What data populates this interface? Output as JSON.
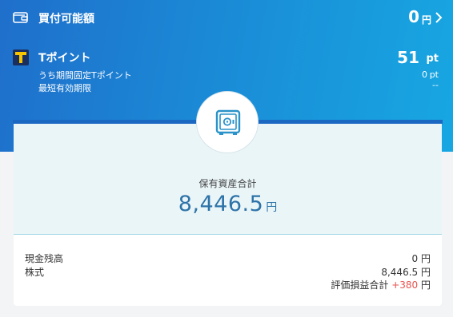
{
  "buying_power": {
    "label": "買付可能額",
    "amount": "0",
    "unit": "円"
  },
  "tpoint": {
    "label": "Tポイント",
    "amount": "51",
    "unit": "pt",
    "fixed_label": "うち期間固定Tポイント",
    "fixed_value": "0",
    "fixed_unit": "pt",
    "expiry_label": "最短有効期限",
    "expiry_value": "--"
  },
  "assets": {
    "total_label": "保有資産合計",
    "total_value": "8,446.5",
    "unit": "円"
  },
  "breakdown": {
    "cash_label": "現金残高",
    "cash_value": "0",
    "stock_label": "株式",
    "stock_value": "8,446.5",
    "pl_label": "評価損益合計",
    "pl_value": "+380",
    "unit": "円"
  },
  "colors": {
    "header": "#1f6fcb",
    "accent": "#2d73a8",
    "gain": "#e8534f",
    "card": "#eaf5f8"
  },
  "icons": [
    "wallet-icon",
    "chevron-right-icon",
    "tpoint-logo-icon",
    "safe-icon"
  ]
}
